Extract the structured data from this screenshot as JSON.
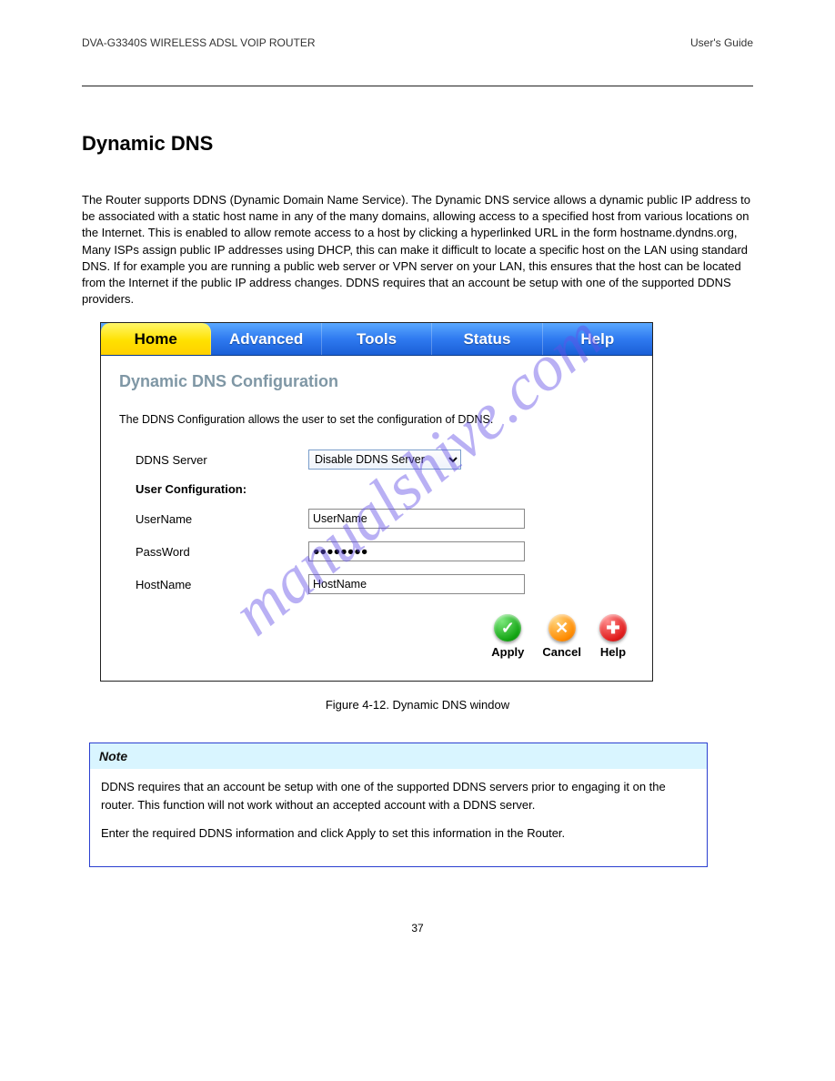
{
  "header": {
    "left": "DVA-G3340S WIRELESS ADSL VOIP ROUTER",
    "right": "User's Guide"
  },
  "section_title": "Dynamic DNS",
  "intro": "The Router supports DDNS (Dynamic Domain Name Service). The Dynamic DNS service allows a dynamic public IP address to be associated with a static host name in any of the many domains, allowing access to a specified host from various locations on the Internet. This is enabled to allow remote access to a host by clicking a hyperlinked URL in the form hostname.dyndns.org, Many ISPs assign public IP addresses using DHCP, this can make it difficult to locate a specific host on the LAN using standard DNS. If for example you are running a public web server or VPN server on your LAN, this ensures that the host can be located from the Internet if the public IP address changes. DDNS requires that an account be setup with one of the supported DDNS providers.",
  "tabs": [
    "Home",
    "Advanced",
    "Tools",
    "Status",
    "Help"
  ],
  "panel": {
    "title": "Dynamic DNS Configuration",
    "desc": "The DDNS Configuration allows the user to set the configuration of DDNS.",
    "ddns_label": "DDNS Server",
    "ddns_value": "Disable DDNS Server",
    "user_config_label": "User Configuration:",
    "username_label": "UserName",
    "username_value": "UserName",
    "password_label": "PassWord",
    "password_value": "●●●●●●●●",
    "hostname_label": "HostName",
    "hostname_value": "HostName"
  },
  "actions": {
    "apply": "Apply",
    "cancel": "Cancel",
    "help": "Help"
  },
  "figure_caption": "Figure 4-12. Dynamic DNS window",
  "note": {
    "head": "Note",
    "p1": "DDNS requires that an account be setup with one of the supported DDNS servers prior to engaging it on the router. This function will not work without an accepted account with a DDNS server.",
    "p2": "Enter the required DDNS information and click Apply to set this information in the Router."
  },
  "page_number": "37",
  "watermark": "manualshive.com"
}
